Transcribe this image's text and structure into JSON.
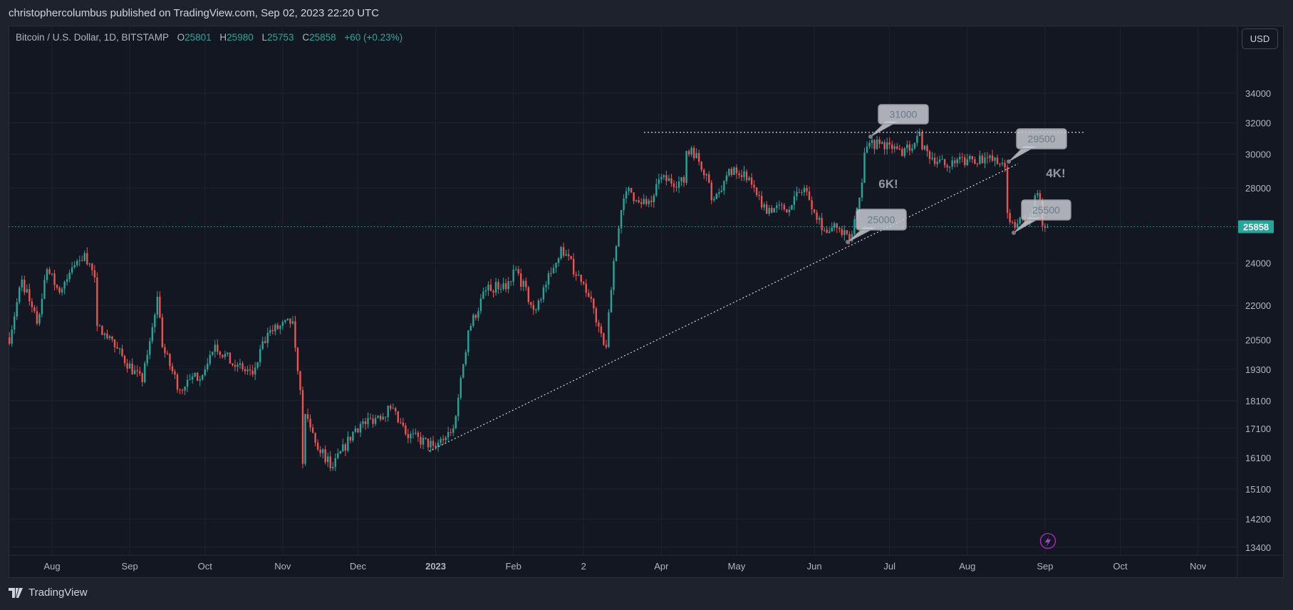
{
  "header": {
    "published": "christophercolumbus published on TradingView.com, Sep 02, 2023 22:20 UTC"
  },
  "legend": {
    "symbol": "Bitcoin / U.S. Dollar, 1D, BITSTAMP",
    "o_label": "O",
    "o": "25801",
    "h_label": "H",
    "h": "25980",
    "l_label": "L",
    "l": "25753",
    "c_label": "C",
    "c": "25858",
    "change": "+60 (+0.23%)"
  },
  "currency_button": "USD",
  "footer": {
    "brand": "TradingView",
    "logo_text": "TV"
  },
  "colors": {
    "up": "#26a69a",
    "down": "#ef5350",
    "background": "#131722",
    "last_price": "#26a69a",
    "lightning": "#9c27b0"
  },
  "chart_data": {
    "type": "candlestick",
    "title": "Bitcoin / U.S. Dollar, 1D, BITSTAMP",
    "scale": "log",
    "ylim": [
      13400,
      34000
    ],
    "last_price": 25858,
    "last_price_label": "25858",
    "y_ticks": [
      "34000",
      "32000",
      "30000",
      "28000",
      "24000",
      "22000",
      "20500",
      "19300",
      "18100",
      "17100",
      "16100",
      "15100",
      "14200",
      "13400"
    ],
    "x_ticks": [
      {
        "label": "Aug",
        "date": "2022-08-01"
      },
      {
        "label": "Sep",
        "date": "2022-09-01"
      },
      {
        "label": "Oct",
        "date": "2022-10-01"
      },
      {
        "label": "Nov",
        "date": "2022-11-01"
      },
      {
        "label": "Dec",
        "date": "2022-12-01"
      },
      {
        "label": "2023",
        "date": "2023-01-01",
        "bold": true
      },
      {
        "label": "Feb",
        "date": "2023-02-01"
      },
      {
        "label": "2",
        "date": "2023-03-01"
      },
      {
        "label": "Apr",
        "date": "2023-04-01"
      },
      {
        "label": "May",
        "date": "2023-05-01"
      },
      {
        "label": "Jun",
        "date": "2023-06-01"
      },
      {
        "label": "Jul",
        "date": "2023-07-01"
      },
      {
        "label": "Aug",
        "date": "2023-08-01"
      },
      {
        "label": "Sep",
        "date": "2023-09-01"
      },
      {
        "label": "Oct",
        "date": "2023-10-01"
      },
      {
        "label": "Nov",
        "date": "2023-11-01"
      }
    ],
    "close_anchors": [
      [
        "2022-07-15",
        20600
      ],
      [
        "2022-07-20",
        23200
      ],
      [
        "2022-07-26",
        21200
      ],
      [
        "2022-07-30",
        23700
      ],
      [
        "2022-08-04",
        22600
      ],
      [
        "2022-08-10",
        23900
      ],
      [
        "2022-08-14",
        24500
      ],
      [
        "2022-08-18",
        23300
      ],
      [
        "2022-08-19",
        21100
      ],
      [
        "2022-08-26",
        20200
      ],
      [
        "2022-09-06",
        18800
      ],
      [
        "2022-09-12",
        22400
      ],
      [
        "2022-09-14",
        20200
      ],
      [
        "2022-09-21",
        18500
      ],
      [
        "2022-10-01",
        19300
      ],
      [
        "2022-10-05",
        20300
      ],
      [
        "2022-10-13",
        19400
      ],
      [
        "2022-10-20",
        19100
      ],
      [
        "2022-10-26",
        20800
      ],
      [
        "2022-11-05",
        21300
      ],
      [
        "2022-11-08",
        18500
      ],
      [
        "2022-11-09",
        15900
      ],
      [
        "2022-11-10",
        17600
      ],
      [
        "2022-11-14",
        16600
      ],
      [
        "2022-11-21",
        15800
      ],
      [
        "2022-11-30",
        17100
      ],
      [
        "2022-12-14",
        17800
      ],
      [
        "2022-12-20",
        16900
      ],
      [
        "2022-12-31",
        16500
      ],
      [
        "2023-01-08",
        17100
      ],
      [
        "2023-01-14",
        20900
      ],
      [
        "2023-01-21",
        22700
      ],
      [
        "2023-01-31",
        23100
      ],
      [
        "2023-02-02",
        23700
      ],
      [
        "2023-02-09",
        21800
      ],
      [
        "2023-02-16",
        23500
      ],
      [
        "2023-02-20",
        24800
      ],
      [
        "2023-02-28",
        23100
      ],
      [
        "2023-03-03",
        22400
      ],
      [
        "2023-03-10",
        20200
      ],
      [
        "2023-03-13",
        24100
      ],
      [
        "2023-03-17",
        27400
      ],
      [
        "2023-03-19",
        28000
      ],
      [
        "2023-03-22",
        27300
      ],
      [
        "2023-03-28",
        27200
      ],
      [
        "2023-03-31",
        28500
      ],
      [
        "2023-04-10",
        28300
      ],
      [
        "2023-04-11",
        30200
      ],
      [
        "2023-04-13",
        30400
      ],
      [
        "2023-04-19",
        28800
      ],
      [
        "2023-04-21",
        27300
      ],
      [
        "2023-04-26",
        28400
      ],
      [
        "2023-04-30",
        29200
      ],
      [
        "2023-05-06",
        28600
      ],
      [
        "2023-05-11",
        26900
      ],
      [
        "2023-05-20",
        26800
      ],
      [
        "2023-05-28",
        28000
      ],
      [
        "2023-06-05",
        25700
      ],
      [
        "2023-06-10",
        25800
      ],
      [
        "2023-06-15",
        25100
      ],
      [
        "2023-06-20",
        28300
      ],
      [
        "2023-06-21",
        30100
      ],
      [
        "2023-06-23",
        30700
      ],
      [
        "2023-07-01",
        30600
      ],
      [
        "2023-07-06",
        29900
      ],
      [
        "2023-07-13",
        31400
      ],
      [
        "2023-07-14",
        30300
      ],
      [
        "2023-07-24",
        29200
      ],
      [
        "2023-08-01",
        29700
      ],
      [
        "2023-08-08",
        29800
      ],
      [
        "2023-08-14",
        29400
      ],
      [
        "2023-08-16",
        29200
      ],
      [
        "2023-08-17",
        26600
      ],
      [
        "2023-08-18",
        26100
      ],
      [
        "2023-08-25",
        26100
      ],
      [
        "2023-08-29",
        27700
      ],
      [
        "2023-08-30",
        27300
      ],
      [
        "2023-08-31",
        25900
      ],
      [
        "2023-09-01",
        25800
      ],
      [
        "2023-09-02",
        25858
      ]
    ],
    "annotations": {
      "resistance_line_price": 31400,
      "trendline": [
        [
          "2022-12-30",
          16300
        ],
        [
          "2023-08-20",
          29200
        ]
      ],
      "callouts": [
        {
          "label": "31000",
          "date": "2023-06-22",
          "price": 30900
        },
        {
          "label": "29500",
          "date": "2023-08-16",
          "price": 29300
        },
        {
          "label": "25000",
          "date": "2023-06-15",
          "price": 24900
        },
        {
          "label": "25500",
          "date": "2023-08-18",
          "price": 25700
        }
      ],
      "texts": [
        {
          "label": "6K!"
        },
        {
          "label": "4K!"
        }
      ]
    }
  }
}
